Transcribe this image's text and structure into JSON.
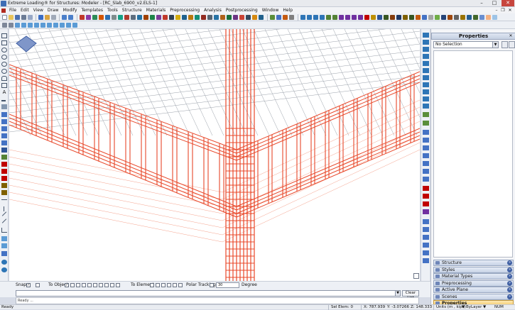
{
  "window": {
    "title": "Extreme Loading® for Structures: Modeler - [RC_Slab_6900_v2.ELS-1]",
    "min_glyph": "–",
    "max_glyph": "□",
    "close_glyph": "✕"
  },
  "menu": [
    "File",
    "Edit",
    "View",
    "Draw",
    "Modify",
    "Templates",
    "Tools",
    "Structure",
    "Materials",
    "Preprocessing",
    "Analysis",
    "Postprocessing",
    "Window",
    "Help"
  ],
  "mdi_controls": {
    "min": "–",
    "restore": "❐",
    "close": "✕"
  },
  "properties": {
    "header": "Properties",
    "selection": "No Selection",
    "close_glyph": "✕",
    "dropdown_arrow": "▼",
    "sections": [
      "Structure",
      "Styles",
      "Material Types",
      "Preprocessing",
      "Active Plane",
      "Scenes",
      "Properties"
    ],
    "active_section": "Properties",
    "chevron": "»"
  },
  "snap": {
    "snap_label": "Snap",
    "to_object_label": "To Object",
    "to_element_label": "To Element",
    "polar_tracking_label": "Polar Tracking",
    "degree_value": "30",
    "degree_label": "Degree",
    "check_mark": "✓"
  },
  "command": {
    "clear_list_label": "Clear List",
    "history_text": "Ready ...",
    "dropdown_arrow": "▼"
  },
  "status": {
    "ready": "Ready",
    "sel_elem": "Sel Elem: 0",
    "x": "X: 787.939",
    "y": "Y: -3.07266",
    "z": "Z: 148.333",
    "units": "Units (m , kips)",
    "layer": "ByLayer",
    "num": "NUM",
    "dropdown_arrow": "▼"
  },
  "colors": {
    "rebar": "#e8482a",
    "rebar_light": "#f4a28c",
    "grid": "#9aa0aa",
    "accent": "#3f5fa3"
  }
}
